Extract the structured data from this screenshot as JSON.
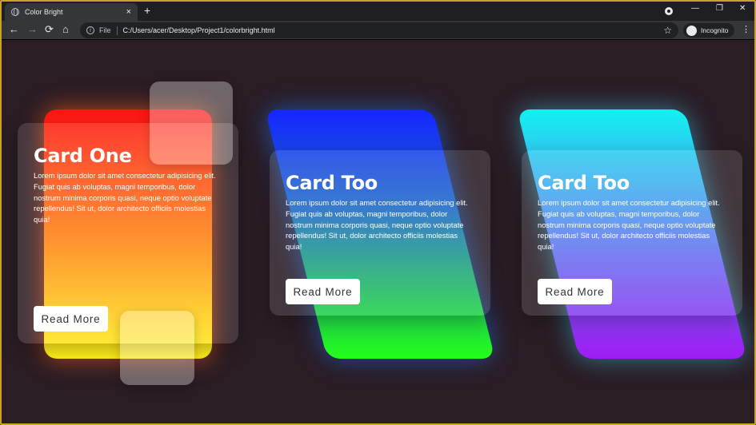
{
  "browser": {
    "tab_title": "Color Bright",
    "tab_close": "×",
    "new_tab": "+",
    "url_scheme": "File",
    "url": "C:/Users/acer/Desktop/Project1/colorbright.html",
    "incognito_label": "Incognito",
    "back_icon": "←",
    "forward_icon": "→",
    "reload_icon": "⟳",
    "home_icon": "⌂",
    "star_icon": "☆",
    "menu_icon": "⋮",
    "minimize_icon": "—",
    "restore_icon": "❐",
    "close_window_icon": "✕",
    "info_icon": "i"
  },
  "cards": [
    {
      "title": "Card One",
      "body": "Lorem ipsum dolor sit amet consectetur adipisicing elit. Fugiat quis ab voluptas, magni temporibus, dolor nostrum minima corporis quasi, neque optio voluptate repellendus! Sit ut, dolor architecto officiis molestias quia!",
      "button": "Read More",
      "gradient": [
        "#ff1414",
        "#fff21a"
      ]
    },
    {
      "title": "Card Too",
      "body": "Lorem ipsum dolor sit amet consectetur adipisicing elit. Fugiat quis ab voluptas, magni temporibus, dolor nostrum minima corporis quasi, neque optio voluptate repellendus! Sit ut, dolor architecto officiis molestias quia!",
      "button": "Read More",
      "gradient": [
        "#1626ff",
        "#22ff1a"
      ]
    },
    {
      "title": "Card Too",
      "body": "Lorem ipsum dolor sit amet consectetur adipisicing elit. Fugiat quis ab voluptas, magni temporibus, dolor nostrum minima corporis quasi, neque optio voluptate repellendus! Sit ut, dolor architecto officiis molestias quia!",
      "button": "Read More",
      "gradient": [
        "#14f0f0",
        "#a01cf5"
      ]
    }
  ],
  "colors": {
    "page_background": "#2a1d25",
    "browser_chrome": "#35363a"
  }
}
